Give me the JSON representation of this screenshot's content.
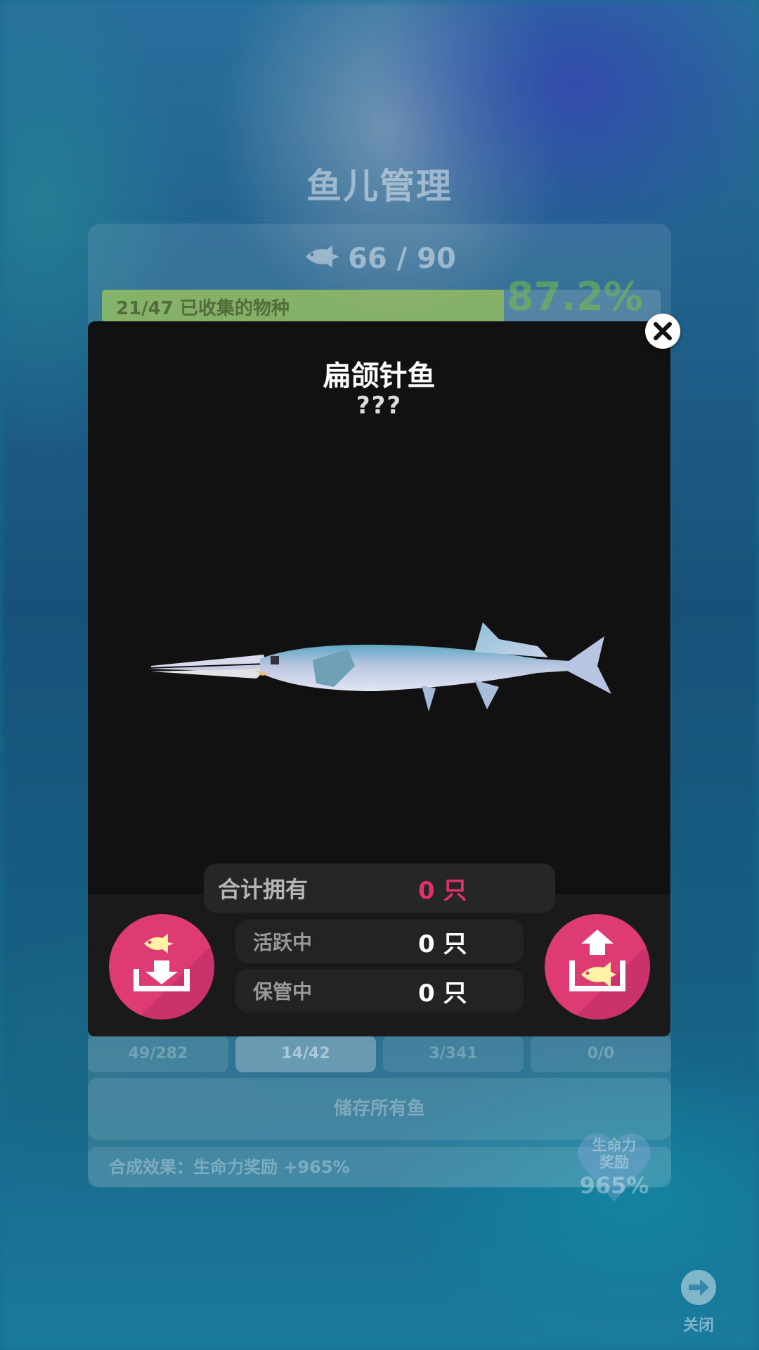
{
  "background": {
    "page_title": "鱼儿管理",
    "fish_count": "66 / 90",
    "collection_progress_text": "21/47 已收集的物种",
    "collection_progress_fraction": 0.72,
    "collection_percent": "87.2%",
    "tabs": [
      {
        "label": "49/282",
        "active": false
      },
      {
        "label": "14/42",
        "active": true
      },
      {
        "label": "3/341",
        "active": false
      },
      {
        "label": "0/0",
        "active": false
      }
    ],
    "store_all_label": "储存所有鱼",
    "synth_effect_text": "合成效果：生命力奖励 +965%",
    "heart_badge": {
      "label": "生命力\n奖励",
      "value": "965%"
    },
    "close_nav_label": "关闭"
  },
  "modal": {
    "title": "扁颌针鱼",
    "subtitle": "???",
    "stats": {
      "total_label": "合计拥有",
      "total_value": "0 只",
      "active_label": "活跃中",
      "active_value": "0 只",
      "stored_label": "保管中",
      "stored_value": "0 只"
    }
  },
  "icons": {
    "close": "close-icon",
    "store_fish": "store-fish-icon",
    "release_fish": "release-fish-icon",
    "fish": "fish-icon",
    "exit_arrow": "arrow-right-circle-icon"
  },
  "colors": {
    "accent_pink": "#de3a74",
    "value_pink": "#e0306e",
    "modal_bg": "#111111"
  }
}
